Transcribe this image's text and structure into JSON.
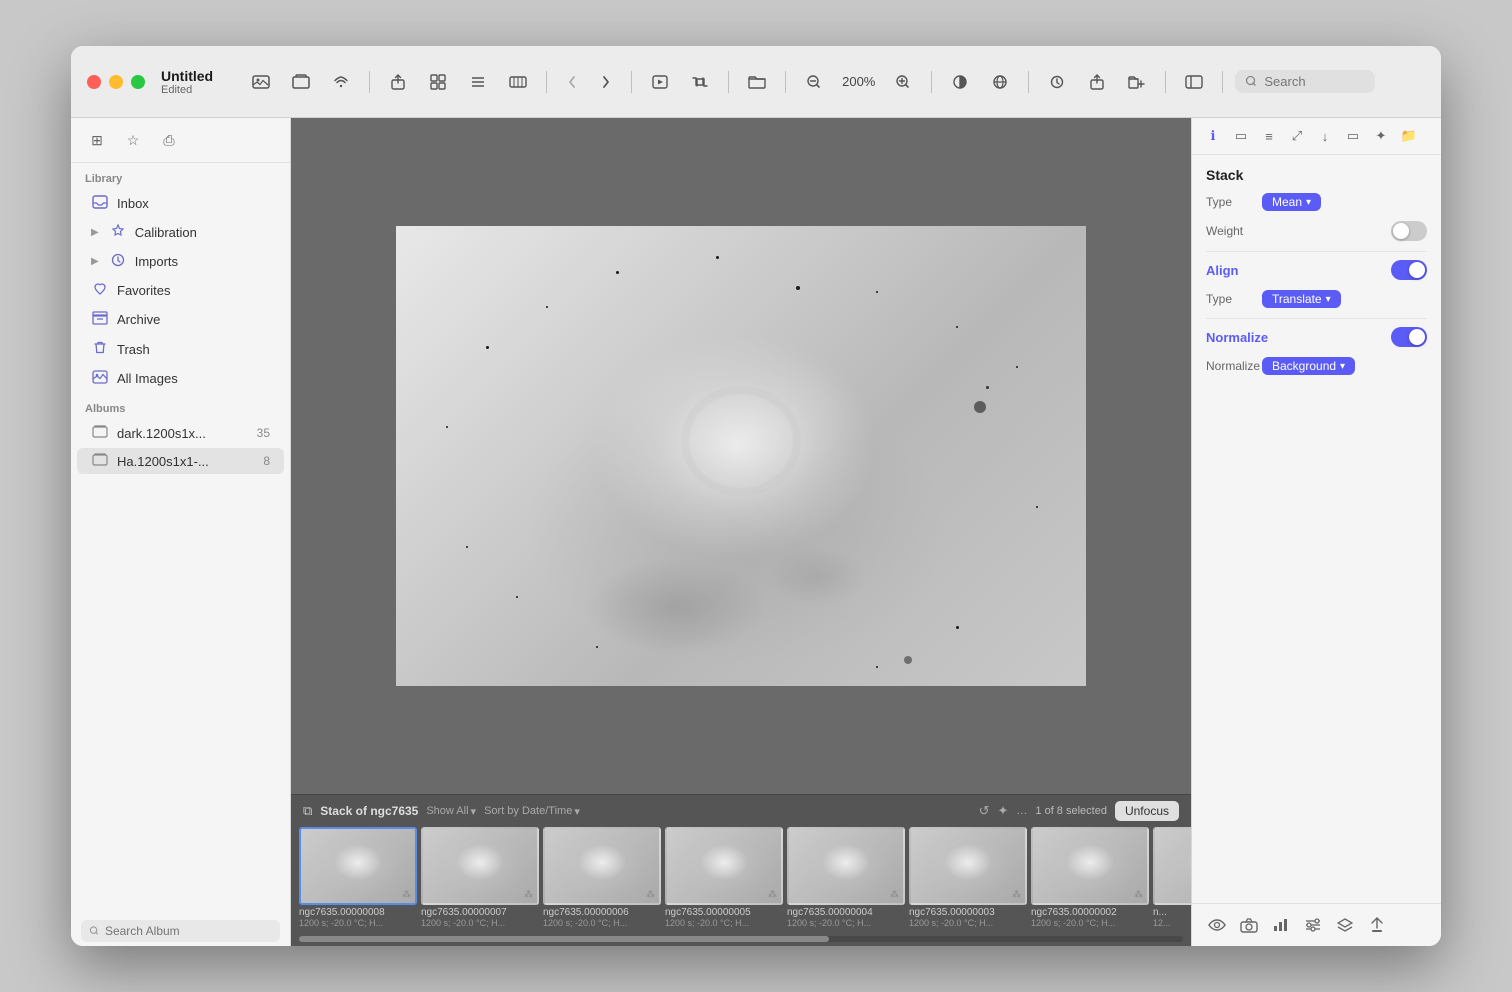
{
  "window": {
    "title": "Untitled",
    "subtitle": "Edited",
    "traffic_lights": [
      "red",
      "yellow",
      "green"
    ]
  },
  "toolbar": {
    "zoom": "200%",
    "search_placeholder": "Search"
  },
  "sidebar": {
    "library_label": "Library",
    "albums_label": "Albums",
    "items": [
      {
        "id": "inbox",
        "label": "Inbox",
        "icon": "📥",
        "count": ""
      },
      {
        "id": "calibration",
        "label": "Calibration",
        "icon": "⭐",
        "count": ""
      },
      {
        "id": "imports",
        "label": "Imports",
        "icon": "🕐",
        "count": ""
      },
      {
        "id": "favorites",
        "label": "Favorites",
        "icon": "♡",
        "count": ""
      },
      {
        "id": "archive",
        "label": "Archive",
        "icon": "🗄",
        "count": ""
      },
      {
        "id": "trash",
        "label": "Trash",
        "icon": "🗑",
        "count": ""
      },
      {
        "id": "all-images",
        "label": "All Images",
        "icon": "📷",
        "count": ""
      }
    ],
    "albums": [
      {
        "id": "dark",
        "label": "dark.1200s1x...",
        "count": "35"
      },
      {
        "id": "ha",
        "label": "Ha.1200s1x1-...",
        "count": "8",
        "active": true
      }
    ],
    "search_placeholder": "Search Album"
  },
  "filmstrip": {
    "stack_label": "Stack of ngc7635",
    "show_all": "Show All",
    "sort_by": "Sort by Date/Time",
    "count_label": "1 of 8 selected",
    "unfocus_label": "Unfocus",
    "items": [
      {
        "name": "ngc7635.00000008",
        "meta": "1200 s; -20.0 °C; H...",
        "selected": true
      },
      {
        "name": "ngc7635.00000007",
        "meta": "1200 s; -20.0 °C; H...",
        "selected": false
      },
      {
        "name": "ngc7635.00000006",
        "meta": "1200 s; -20.0 °C; H...",
        "selected": false
      },
      {
        "name": "ngc7635.00000005",
        "meta": "1200 s; -20.0 °C; H...",
        "selected": false
      },
      {
        "name": "ngc7635.00000004",
        "meta": "1200 s; -20.0 °C; H...",
        "selected": false
      },
      {
        "name": "ngc7635.00000003",
        "meta": "1200 s; -20.0 °C; H...",
        "selected": false
      },
      {
        "name": "ngc7635.00000002",
        "meta": "1200 s; -20.0 °C; H...",
        "selected": false
      },
      {
        "name": "n...",
        "meta": "12...",
        "selected": false
      }
    ]
  },
  "right_panel": {
    "section_title": "Stack",
    "type_label": "Type",
    "type_value": "Mean",
    "weight_label": "Weight",
    "align_label": "Align",
    "align_type_label": "Type",
    "align_type_value": "Translate",
    "normalize_label": "Normalize",
    "normalize_type_label": "Normalize",
    "normalize_type_value": "Background",
    "weight_toggle": false,
    "align_toggle": true,
    "normalize_toggle": true
  }
}
